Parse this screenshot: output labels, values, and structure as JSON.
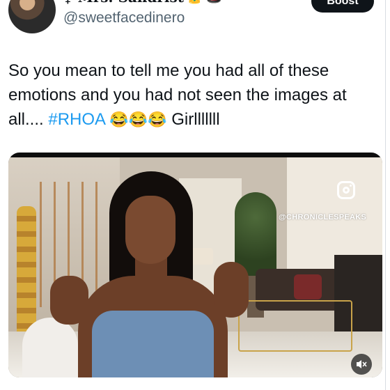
{
  "header": {
    "display_name": "♀ Mrs. Sandrist",
    "badge_emojis": [
      "👑",
      "🎩"
    ],
    "handle": "@sweetfacedinero",
    "boost_label": "Boost"
  },
  "tweet": {
    "text_part1": "So you mean to tell me you had all of these emotions and you had not seen the images at all.... ",
    "hashtag": "#RHOA",
    "emojis": "😂😂😂",
    "text_part2": " Girlllllll"
  },
  "media": {
    "watermark": "@CHRONICLESPEAKS",
    "icons": [
      "instagram-icon",
      "mute-icon"
    ]
  },
  "colors": {
    "accent": "#1d9bf0",
    "text": "#0f1419",
    "secondary": "#536471",
    "button": "#0f1419"
  }
}
